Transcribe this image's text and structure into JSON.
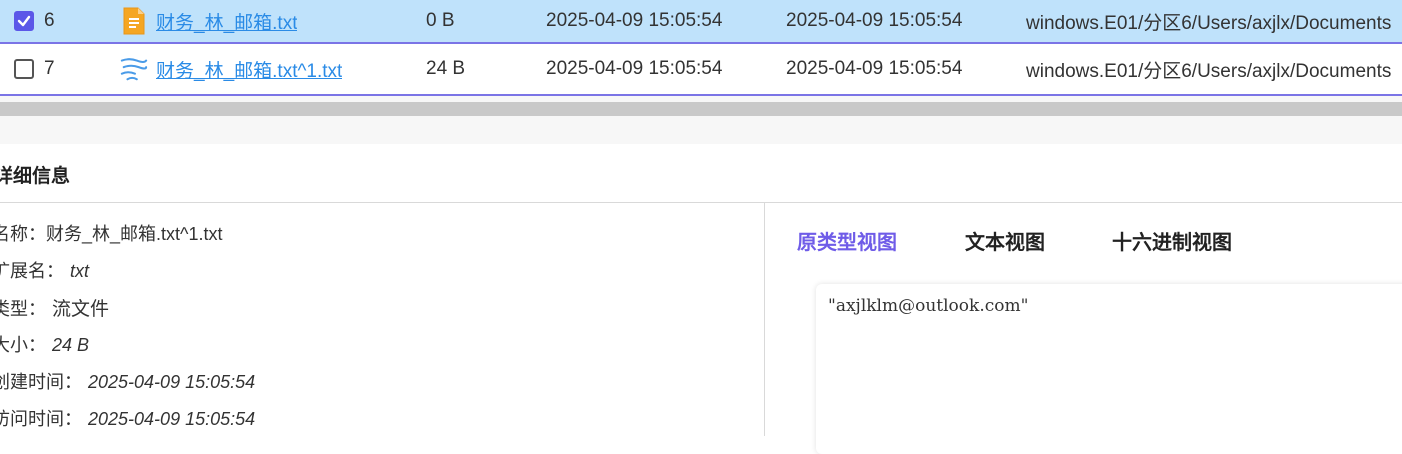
{
  "rows": [
    {
      "checked": true,
      "number": "6",
      "icon": "text-file-icon",
      "name": "财务_林_邮箱.txt",
      "size": "0 B",
      "created": "2025-04-09 15:05:54",
      "modified": "2025-04-09 15:05:54",
      "path": "windows.E01/分区6/Users/axjlx/Documents"
    },
    {
      "checked": false,
      "number": "7",
      "icon": "stream-file-icon",
      "name": "财务_林_邮箱.txt^1.txt",
      "size": "24 B",
      "created": "2025-04-09 15:05:54",
      "modified": "2025-04-09 15:05:54",
      "path": "windows.E01/分区6/Users/axjlx/Documents"
    }
  ],
  "details": {
    "title": "详细信息",
    "fields": {
      "name_label": "名称：",
      "name_value": "财务_林_邮箱.txt^1.txt",
      "ext_label": "扩展名：",
      "ext_value": "txt",
      "type_label": "类型：",
      "type_value": "流文件",
      "size_label": "大小：",
      "size_value": "24 B",
      "ctime_label": "创建时间：",
      "ctime_value": "2025-04-09 15:05:54",
      "atime_label": "访问时间：",
      "atime_value": "2025-04-09 15:05:54"
    }
  },
  "tabs": [
    {
      "label": "原类型视图",
      "active": true
    },
    {
      "label": "文本视图",
      "active": false
    },
    {
      "label": "十六进制视图",
      "active": false
    }
  ],
  "preview": {
    "content": "\"axjlklm@outlook.com\""
  },
  "colors": {
    "selected_row": "#bfe2fb",
    "row_border": "#7b74e6",
    "link": "#2a8be6",
    "checkbox_on": "#5b57e8",
    "active_tab": "#6f5ce8"
  }
}
